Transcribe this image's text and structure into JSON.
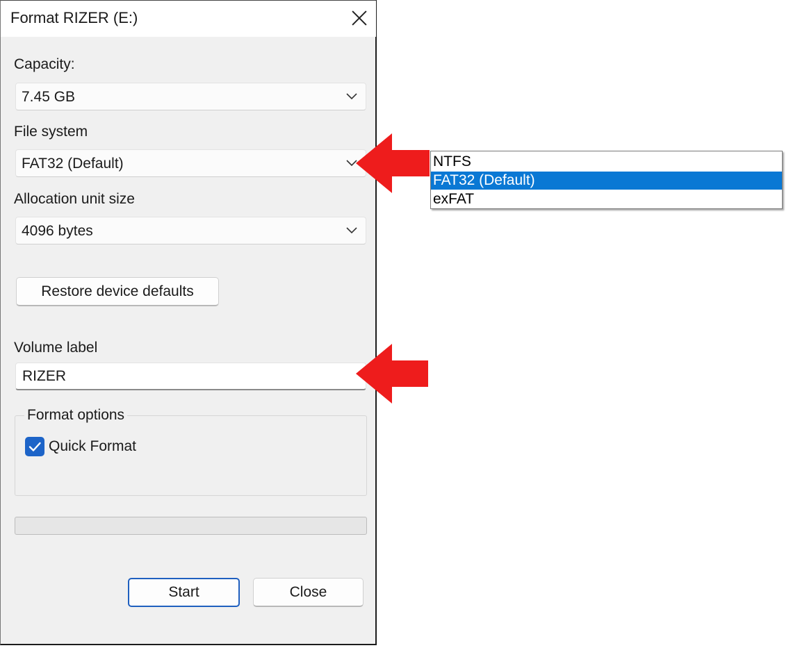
{
  "window": {
    "title": "Format RIZER (E:)"
  },
  "capacity": {
    "label": "Capacity:",
    "value": "7.45 GB"
  },
  "file_system": {
    "label": "File system",
    "value": "FAT32 (Default)",
    "options": [
      "NTFS",
      "FAT32 (Default)",
      "exFAT"
    ]
  },
  "allocation": {
    "label": "Allocation unit size",
    "value": "4096 bytes"
  },
  "restore_button": {
    "label": "Restore device defaults"
  },
  "volume_label": {
    "label": "Volume label",
    "value": "RIZER"
  },
  "format_options": {
    "title": "Format options",
    "quick_format": {
      "label": "Quick Format",
      "checked": true
    }
  },
  "progress": {
    "value": 0
  },
  "buttons": {
    "start": "Start",
    "close": "Close"
  },
  "colors": {
    "accent": "#1d64c8",
    "selection": "#0a78d4",
    "annotation_arrow": "#ee1c1c"
  },
  "icons": [
    "close-icon",
    "chevron-down-icon",
    "checkmark-icon",
    "red-arrow-annotation"
  ]
}
